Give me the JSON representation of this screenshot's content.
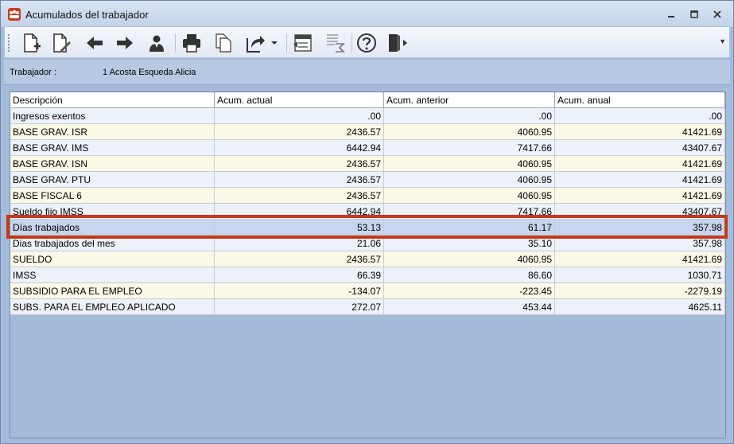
{
  "window": {
    "title": "Acumulados del trabajador",
    "minimize_glyph": "▭",
    "restore_glyph": "◻",
    "close_glyph": "✕"
  },
  "toolbar": {
    "icons": [
      "new-document-icon",
      "edit-document-icon",
      "arrow-left-icon",
      "arrow-right-icon",
      "worker-icon",
      "print-icon",
      "copy-icon",
      "export-icon",
      "grid-transfer-icon",
      "sum-grid-icon",
      "help-icon",
      "exit-icon"
    ],
    "more_glyph": "▼"
  },
  "info": {
    "trabajador_label": "Trabajador :",
    "trabajador_value": "1 Acosta Esqueda Alicia"
  },
  "table": {
    "columns": [
      "Descripción",
      "Acum. actual",
      "Acum. anterior",
      "Acum. anual"
    ],
    "rows": [
      {
        "descripcion": "Ingresos exentos",
        "actual": ".00",
        "anterior": ".00",
        "anual": ".00"
      },
      {
        "descripcion": " BASE GRAV. ISR",
        "actual": "2436.57",
        "anterior": "4060.95",
        "anual": "41421.69"
      },
      {
        "descripcion": " BASE GRAV. IMS",
        "actual": "6442.94",
        "anterior": "7417.66",
        "anual": "43407.67"
      },
      {
        "descripcion": " BASE GRAV. ISN",
        "actual": "2436.57",
        "anterior": "4060.95",
        "anual": "41421.69"
      },
      {
        "descripcion": " BASE GRAV. PTU",
        "actual": "2436.57",
        "anterior": "4060.95",
        "anual": "41421.69"
      },
      {
        "descripcion": " BASE FISCAL 6",
        "actual": "2436.57",
        "anterior": "4060.95",
        "anual": "41421.69"
      },
      {
        "descripcion": "Sueldo fijo IMSS",
        "actual": "6442.94",
        "anterior": "7417.66",
        "anual": "43407.67"
      },
      {
        "descripcion": "Días trabajados",
        "actual": "53.13",
        "anterior": "61.17",
        "anual": "357.98"
      },
      {
        "descripcion": "Dias trabajados del mes",
        "actual": "21.06",
        "anterior": "35.10",
        "anual": "357.98"
      },
      {
        "descripcion": "SUELDO",
        "actual": "2436.57",
        "anterior": "4060.95",
        "anual": "41421.69"
      },
      {
        "descripcion": "IMSS",
        "actual": "66.39",
        "anterior": "86.60",
        "anual": "1030.71"
      },
      {
        "descripcion": "SUBSIDIO PARA EL EMPLEO",
        "actual": "-134.07",
        "anterior": "-223.45",
        "anual": "-2279.19"
      },
      {
        "descripcion": "SUBS. PARA EL EMPLEO APLICADO",
        "actual": "272.07",
        "anterior": "453.44",
        "anual": "4625.11"
      }
    ],
    "selected_row": 7
  },
  "colors": {
    "highlight_border": "#c4391b",
    "selected_row": "#c7d6ee",
    "row_odd": "#edf1f8",
    "row_even": "#faf8e6"
  }
}
